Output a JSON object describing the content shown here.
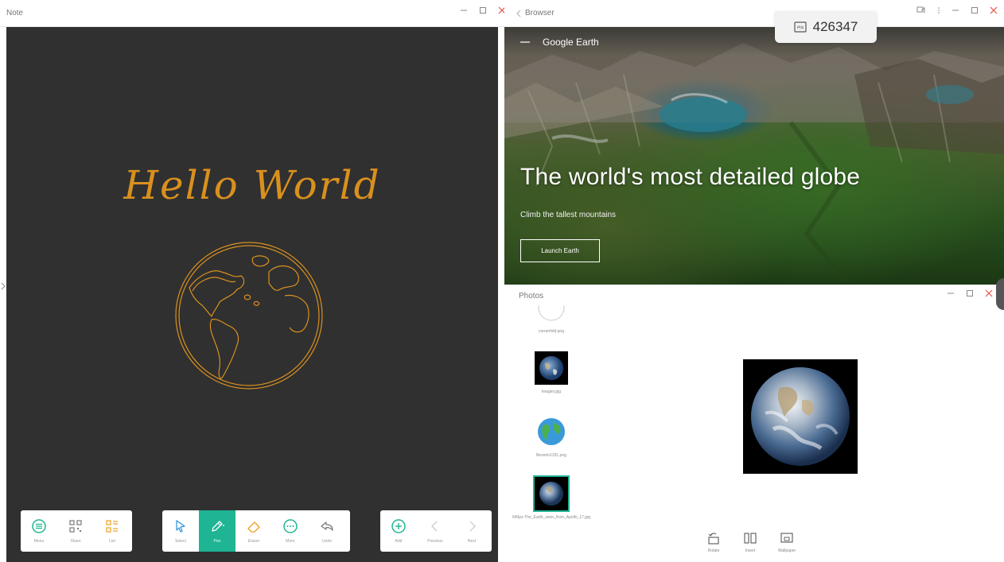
{
  "note": {
    "title": "Note",
    "handwriting": "Hello World",
    "toolbar_left": [
      {
        "label": "Menu",
        "icon": "menu-icon"
      },
      {
        "label": "Share",
        "icon": "qr-icon"
      },
      {
        "label": "List",
        "icon": "list-icon"
      }
    ],
    "toolbar_center": [
      {
        "label": "Select",
        "icon": "select-cursor-icon"
      },
      {
        "label": "Pen",
        "icon": "pen-icon",
        "active": true
      },
      {
        "label": "Eraser",
        "icon": "eraser-icon"
      },
      {
        "label": "More",
        "icon": "more-icon"
      },
      {
        "label": "Undo",
        "icon": "undo-icon"
      }
    ],
    "toolbar_right": [
      {
        "label": "Add",
        "icon": "add-icon"
      },
      {
        "label": "Previous",
        "icon": "chevron-left-icon"
      },
      {
        "label": "Next",
        "icon": "chevron-right-icon"
      }
    ],
    "pen_color": "#d9901e",
    "canvas_color": "#303030",
    "accent": "#1fb493"
  },
  "browser": {
    "title": "Browser",
    "site_title": "Google Earth",
    "hero": "The world's most detailed globe",
    "subtitle": "Climb the tallest mountains",
    "cta": "Launch Earth"
  },
  "meeting": {
    "code": "426347"
  },
  "photos": {
    "title": "Photos",
    "files": [
      {
        "name": "cornerfold.png"
      },
      {
        "name": "images.jpg"
      },
      {
        "name": "Beverlo1331.png"
      },
      {
        "name": "640px-The_Earth_seen_from_Apollo_17.jpg"
      }
    ],
    "actions": [
      {
        "label": "Rotate",
        "icon": "rotate-icon"
      },
      {
        "label": "Insert",
        "icon": "insert-icon"
      },
      {
        "label": "Wallpaper",
        "icon": "wallpaper-icon"
      }
    ]
  }
}
